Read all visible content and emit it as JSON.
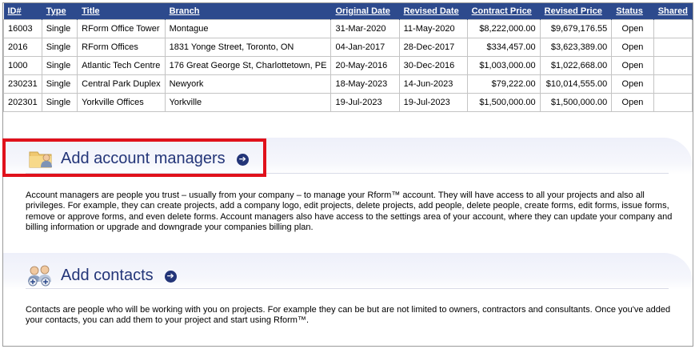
{
  "table": {
    "headers": [
      "ID#",
      "Type",
      "Title",
      "Branch",
      "Original Date",
      "Revised Date",
      "Contract Price",
      "Revised Price",
      "Status",
      "Shared"
    ],
    "rows": [
      [
        "16003",
        "Single",
        "RForm Office Tower",
        "Montague",
        "31-Mar-2020",
        "11-May-2020",
        "$8,222,000.00",
        "$9,679,176.55",
        "Open",
        ""
      ],
      [
        "2016",
        "Single",
        "RForm Offices",
        "1831 Yonge Street, Toronto, ON",
        "04-Jan-2017",
        "28-Dec-2017",
        "$334,457.00",
        "$3,623,389.00",
        "Open",
        ""
      ],
      [
        "1000",
        "Single",
        "Atlantic Tech Centre",
        "176 Great George St, Charlottetown, PE",
        "20-May-2016",
        "30-Dec-2016",
        "$1,003,000.00",
        "$1,022,668.00",
        "Open",
        ""
      ],
      [
        "230231",
        "Single",
        "Central Park Duplex",
        "Newyork",
        "18-May-2023",
        "14-Jun-2023",
        "$79,222.00",
        "$10,014,555.00",
        "Open",
        ""
      ],
      [
        "202301",
        "Single",
        "Yorkville Offices",
        "Yorkville",
        "19-Jul-2023",
        "19-Jul-2023",
        "$1,500,000.00",
        "$1,500,000.00",
        "Open",
        ""
      ]
    ]
  },
  "account_managers": {
    "title": "Add account managers",
    "arrow": "➔",
    "icon": "folder-user-icon",
    "body": "Account managers are people you trust – usually from your company – to manage your Rform™ account. They will have access to all your projects and also all privileges. For example, they can create projects, add a company logo, edit projects, delete projects, add people, delete people, create forms, edit forms, issue forms, remove or approve forms, and even delete forms. Account managers also have access to the settings area of your account, where they can update your company and billing information or upgrade and downgrade your companies billing plan."
  },
  "contacts": {
    "title": "Add contacts",
    "arrow": "➔",
    "icon": "add-people-icon",
    "body": "Contacts are people who will be working with you on projects. For example they can be but are not limited to owners, contractors and consultants. Once you've added your contacts, you can add them to your project and start using Rform™."
  },
  "colors": {
    "header_bg": "#2d4a8d",
    "title_color": "#233578",
    "highlight": "#e0111b"
  }
}
